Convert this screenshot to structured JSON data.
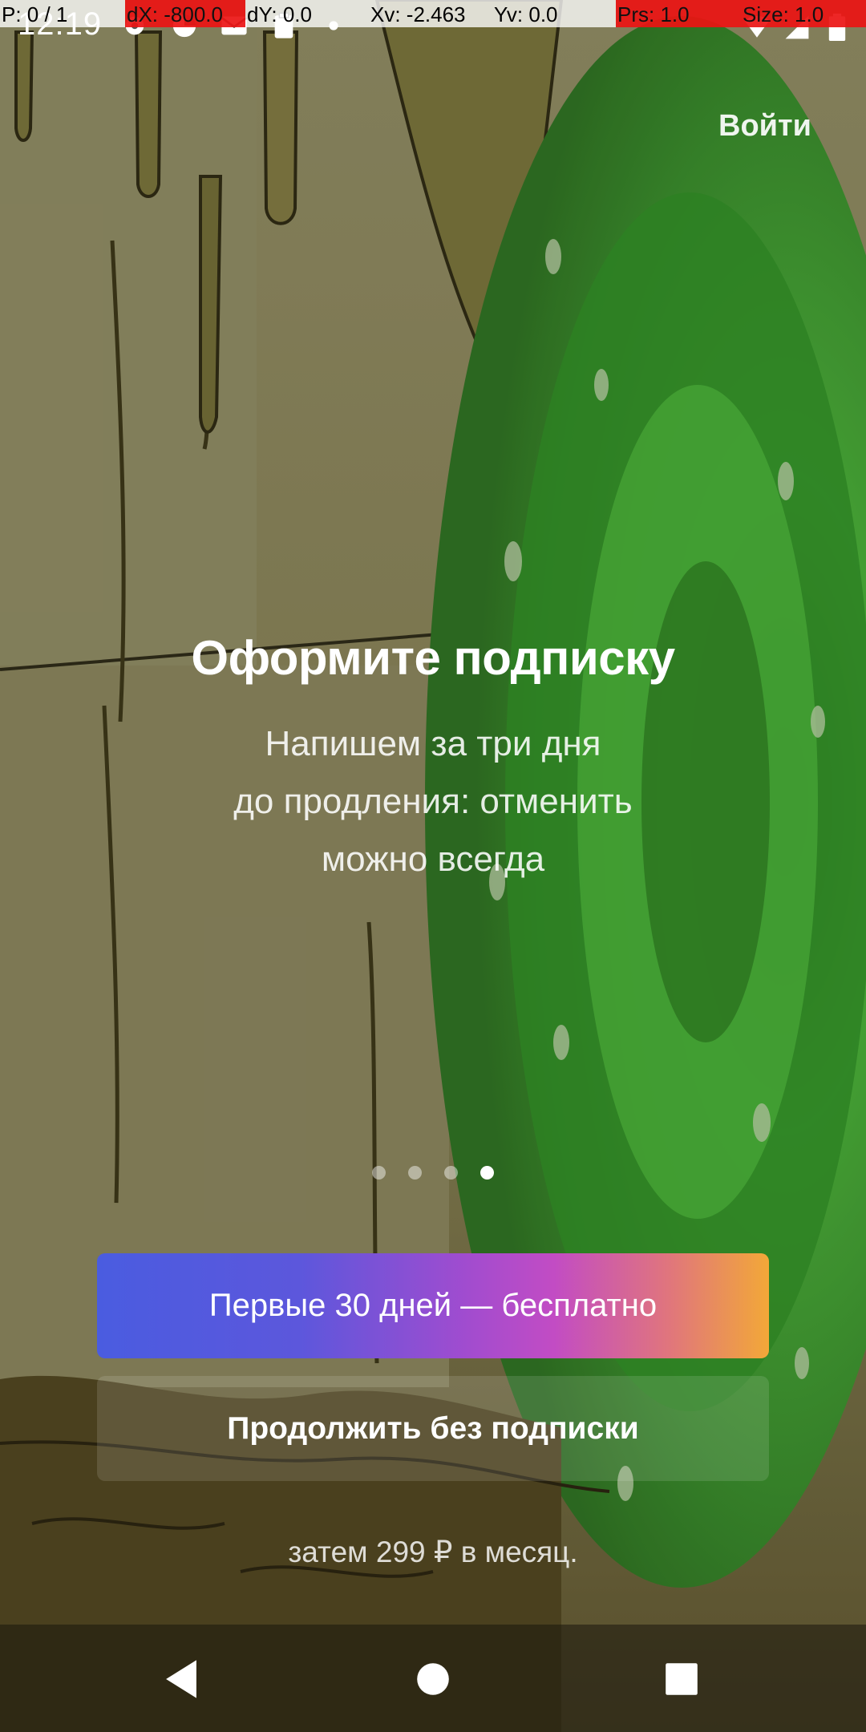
{
  "debug": {
    "pointer": "P: 0 / 1",
    "dx": "dX: -800.0",
    "dy": "dY: 0.0",
    "xv": "Xv: -2.463",
    "yv": "Yv: 0.0",
    "prs": "Prs: 1.0",
    "size": "Size: 1.0"
  },
  "status": {
    "time": "12:19",
    "icons_left": [
      "settings-icon",
      "data-saver-icon",
      "email-icon",
      "clipboard-icon",
      "dot-icon"
    ],
    "icons_right": [
      "wifi-icon",
      "signal-icon",
      "battery-icon"
    ]
  },
  "header": {
    "login_label": "Войти"
  },
  "promo": {
    "title": "Оформите подписку",
    "subtitle_line1": "Напишем за три дня",
    "subtitle_line2": "до продления: отменить",
    "subtitle_line3": "можно всегда"
  },
  "pager": {
    "count": 4,
    "active_index": 3
  },
  "actions": {
    "primary_label": "Первые 30 дней — бесплатно",
    "secondary_label": "Продолжить без подписки",
    "price_note": "затем 299 ₽ в месяц."
  },
  "nav": {
    "items": [
      "back-icon",
      "home-icon",
      "recents-icon"
    ]
  },
  "colors": {
    "gradient_start": "#4a5ce0",
    "gradient_mid": "#c24cc4",
    "gradient_end": "#f2a838",
    "portal_green": "#3f9a32",
    "wall": "#8a8458"
  }
}
